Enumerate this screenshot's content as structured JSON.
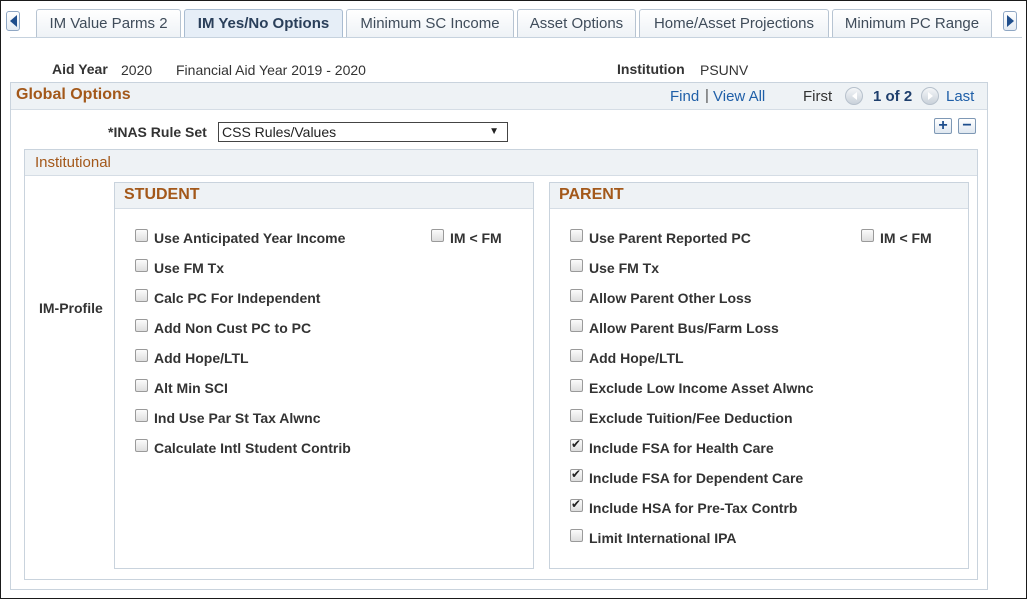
{
  "tabs": [
    {
      "label": "IM Value Parms 2",
      "active": false
    },
    {
      "label": "IM Yes/No Options",
      "active": true
    },
    {
      "label": "Minimum SC Income",
      "active": false
    },
    {
      "label": "Asset Options",
      "active": false
    },
    {
      "label": "Home/Asset Projections",
      "active": false
    },
    {
      "label": "Minimum PC Range",
      "active": false
    }
  ],
  "header": {
    "aid_year_label": "Aid Year",
    "aid_year_value": "2020",
    "aid_year_desc": "Financial Aid Year 2019 - 2020",
    "institution_label": "Institution",
    "institution_value": "PSUNV"
  },
  "global_options": {
    "title": "Global Options",
    "find_label": "Find",
    "separator": "|",
    "view_all_label": "View All",
    "first_label": "First",
    "page_indicator": "1 of 2",
    "last_label": "Last",
    "rule_set_label": "*INAS Rule Set",
    "rule_set_value": "CSS Rules/Values",
    "add_row_symbol": "+",
    "delete_row_symbol": "−"
  },
  "institutional": {
    "title": "Institutional",
    "im_profile_label": "IM-Profile",
    "student": {
      "title": "STUDENT",
      "im_lt_fm": {
        "label": "IM < FM",
        "checked": false
      },
      "items": [
        {
          "label": "Use Anticipated Year Income",
          "checked": false
        },
        {
          "label": "Use FM Tx",
          "checked": false
        },
        {
          "label": "Calc PC For Independent",
          "checked": false
        },
        {
          "label": "Add Non Cust PC to PC",
          "checked": false
        },
        {
          "label": "Add Hope/LTL",
          "checked": false
        },
        {
          "label": "Alt Min SCI",
          "checked": false
        },
        {
          "label": "Ind Use Par St Tax Alwnc",
          "checked": false
        },
        {
          "label": "Calculate Intl Student Contrib",
          "checked": false
        }
      ]
    },
    "parent": {
      "title": "PARENT",
      "im_lt_fm": {
        "label": "IM < FM",
        "checked": false
      },
      "items": [
        {
          "label": "Use Parent Reported PC",
          "checked": false
        },
        {
          "label": "Use FM Tx",
          "checked": false
        },
        {
          "label": "Allow Parent Other Loss",
          "checked": false
        },
        {
          "label": "Allow Parent Bus/Farm Loss",
          "checked": false
        },
        {
          "label": "Add Hope/LTL",
          "checked": false
        },
        {
          "label": "Exclude Low Income Asset Alwnc",
          "checked": false
        },
        {
          "label": "Exclude Tuition/Fee Deduction",
          "checked": false
        },
        {
          "label": "Include FSA for Health Care",
          "checked": true
        },
        {
          "label": "Include FSA for Dependent Care",
          "checked": true
        },
        {
          "label": "Include HSA for Pre-Tax Contrb",
          "checked": true
        },
        {
          "label": "Limit International IPA",
          "checked": false
        }
      ]
    }
  },
  "colors": {
    "section_title": "#a3581a",
    "link": "#1f5fa8",
    "header_bg": "#eef2f5"
  }
}
